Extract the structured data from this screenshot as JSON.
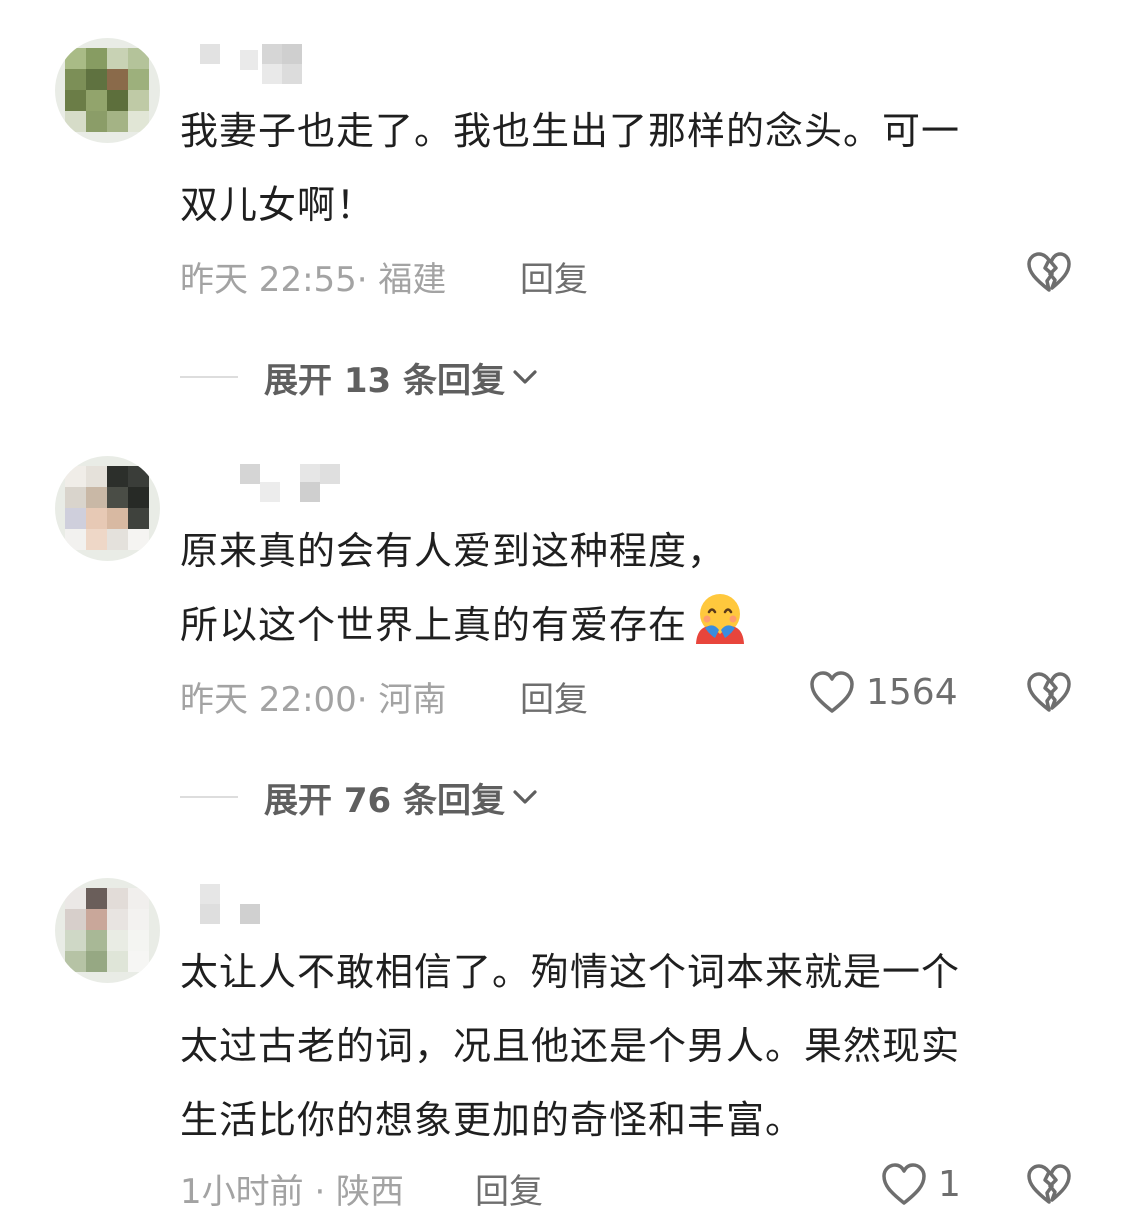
{
  "comments": [
    {
      "text_lines": [
        "我妻子也走了。我也生出了那样的念头。可一",
        "双儿女啊！"
      ],
      "meta": "昨天 22:55· 福建",
      "reply_label": "回复",
      "like_count": "",
      "expand_label": "展开 13 条回复"
    },
    {
      "text_lines": [
        "原来真的会有人爱到这种程度，",
        "所以这个世界上真的有爱存在"
      ],
      "emoji": "hugging-face-emoji",
      "meta": "昨天 22:00· 河南",
      "reply_label": "回复",
      "like_count": "1564",
      "expand_label": "展开 76 条回复"
    },
    {
      "text_lines": [
        "太让人不敢相信了。殉情这个词本来就是一个",
        "太过古老的词，况且他还是个男人。果然现实",
        "生活比你的想象更加的奇怪和丰富。"
      ],
      "meta": "1小时前 · 陕西",
      "reply_label": "回复",
      "like_count": "1"
    }
  ],
  "icons": {
    "like": "heart-outline-icon",
    "dislike": "broken-heart-icon",
    "expand": "chevron-down-icon"
  },
  "colors": {
    "text": "#1f1f1f",
    "meta": "#a3a3a3",
    "action": "#6e6e6e"
  }
}
